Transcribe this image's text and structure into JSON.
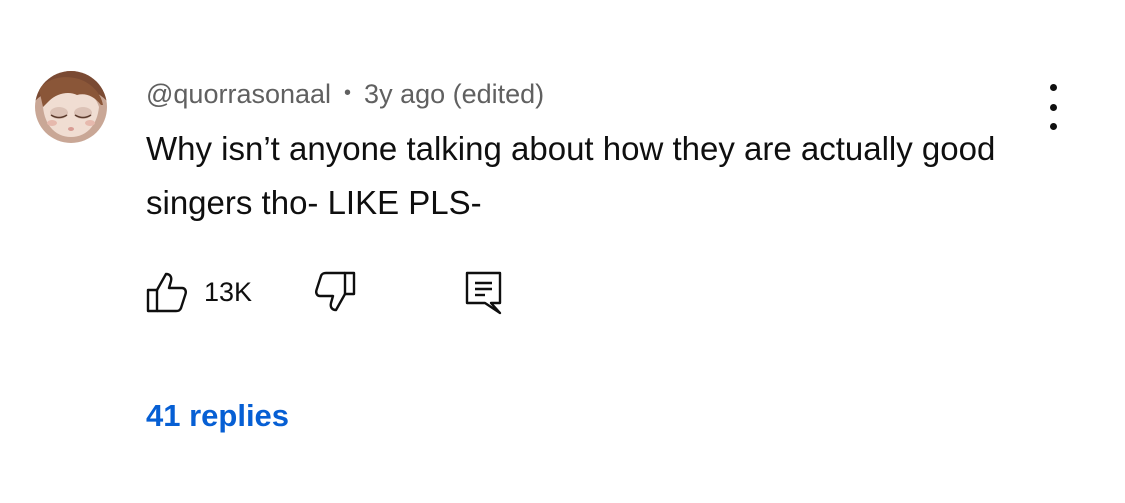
{
  "comment": {
    "author": "@quorrasonaal",
    "separator": "•",
    "time": "3y ago (edited)",
    "text": "Why isn’t anyone talking about how they are actually good singers tho- LIKE PLS-",
    "like_count": "13K",
    "replies_label": "41 replies"
  },
  "icons": {
    "avatar": "avatar-image",
    "like": "thumbs-up-icon",
    "dislike": "thumbs-down-icon",
    "reply": "comment-reply-icon",
    "more": "vertical-ellipsis-icon"
  },
  "colors": {
    "text_primary": "#0f0f0f",
    "text_secondary": "#606060",
    "link": "#065fd4"
  }
}
